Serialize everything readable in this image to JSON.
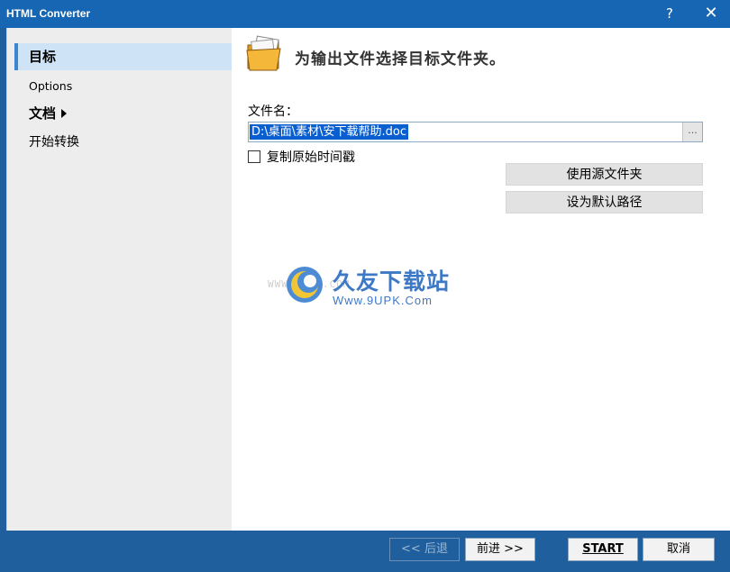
{
  "window": {
    "title": "HTML Converter",
    "help_glyph": "?",
    "close_glyph": "✕"
  },
  "sidebar": {
    "items": [
      {
        "label": "目标"
      },
      {
        "label": "Options"
      },
      {
        "label": "文档"
      },
      {
        "label": "开始转换"
      }
    ]
  },
  "main": {
    "heading": "为输出文件选择目标文件夹。",
    "file_label": "文件名：",
    "file_value": "D:\\桌面\\素材\\安下载帮助.doc",
    "browse_label": "...",
    "checkbox_label": "复制原始时间戳",
    "use_source_folder": "使用源文件夹",
    "set_default_path": "设为默认路径"
  },
  "watermark": {
    "url_left": "WWW.9UPK.COM",
    "brand_cn": "久友下载站",
    "brand_url": "Www.9UPK.Com"
  },
  "footer": {
    "back": "<< 后退",
    "next": "前进 >>",
    "start": "START",
    "cancel": "取消"
  },
  "colors": {
    "titlebar": "#1766b3",
    "frame": "#1f5f9e",
    "sidebar_bg": "#ededed",
    "active_item": "#cfe3f6",
    "selection": "#0a5fd0"
  }
}
